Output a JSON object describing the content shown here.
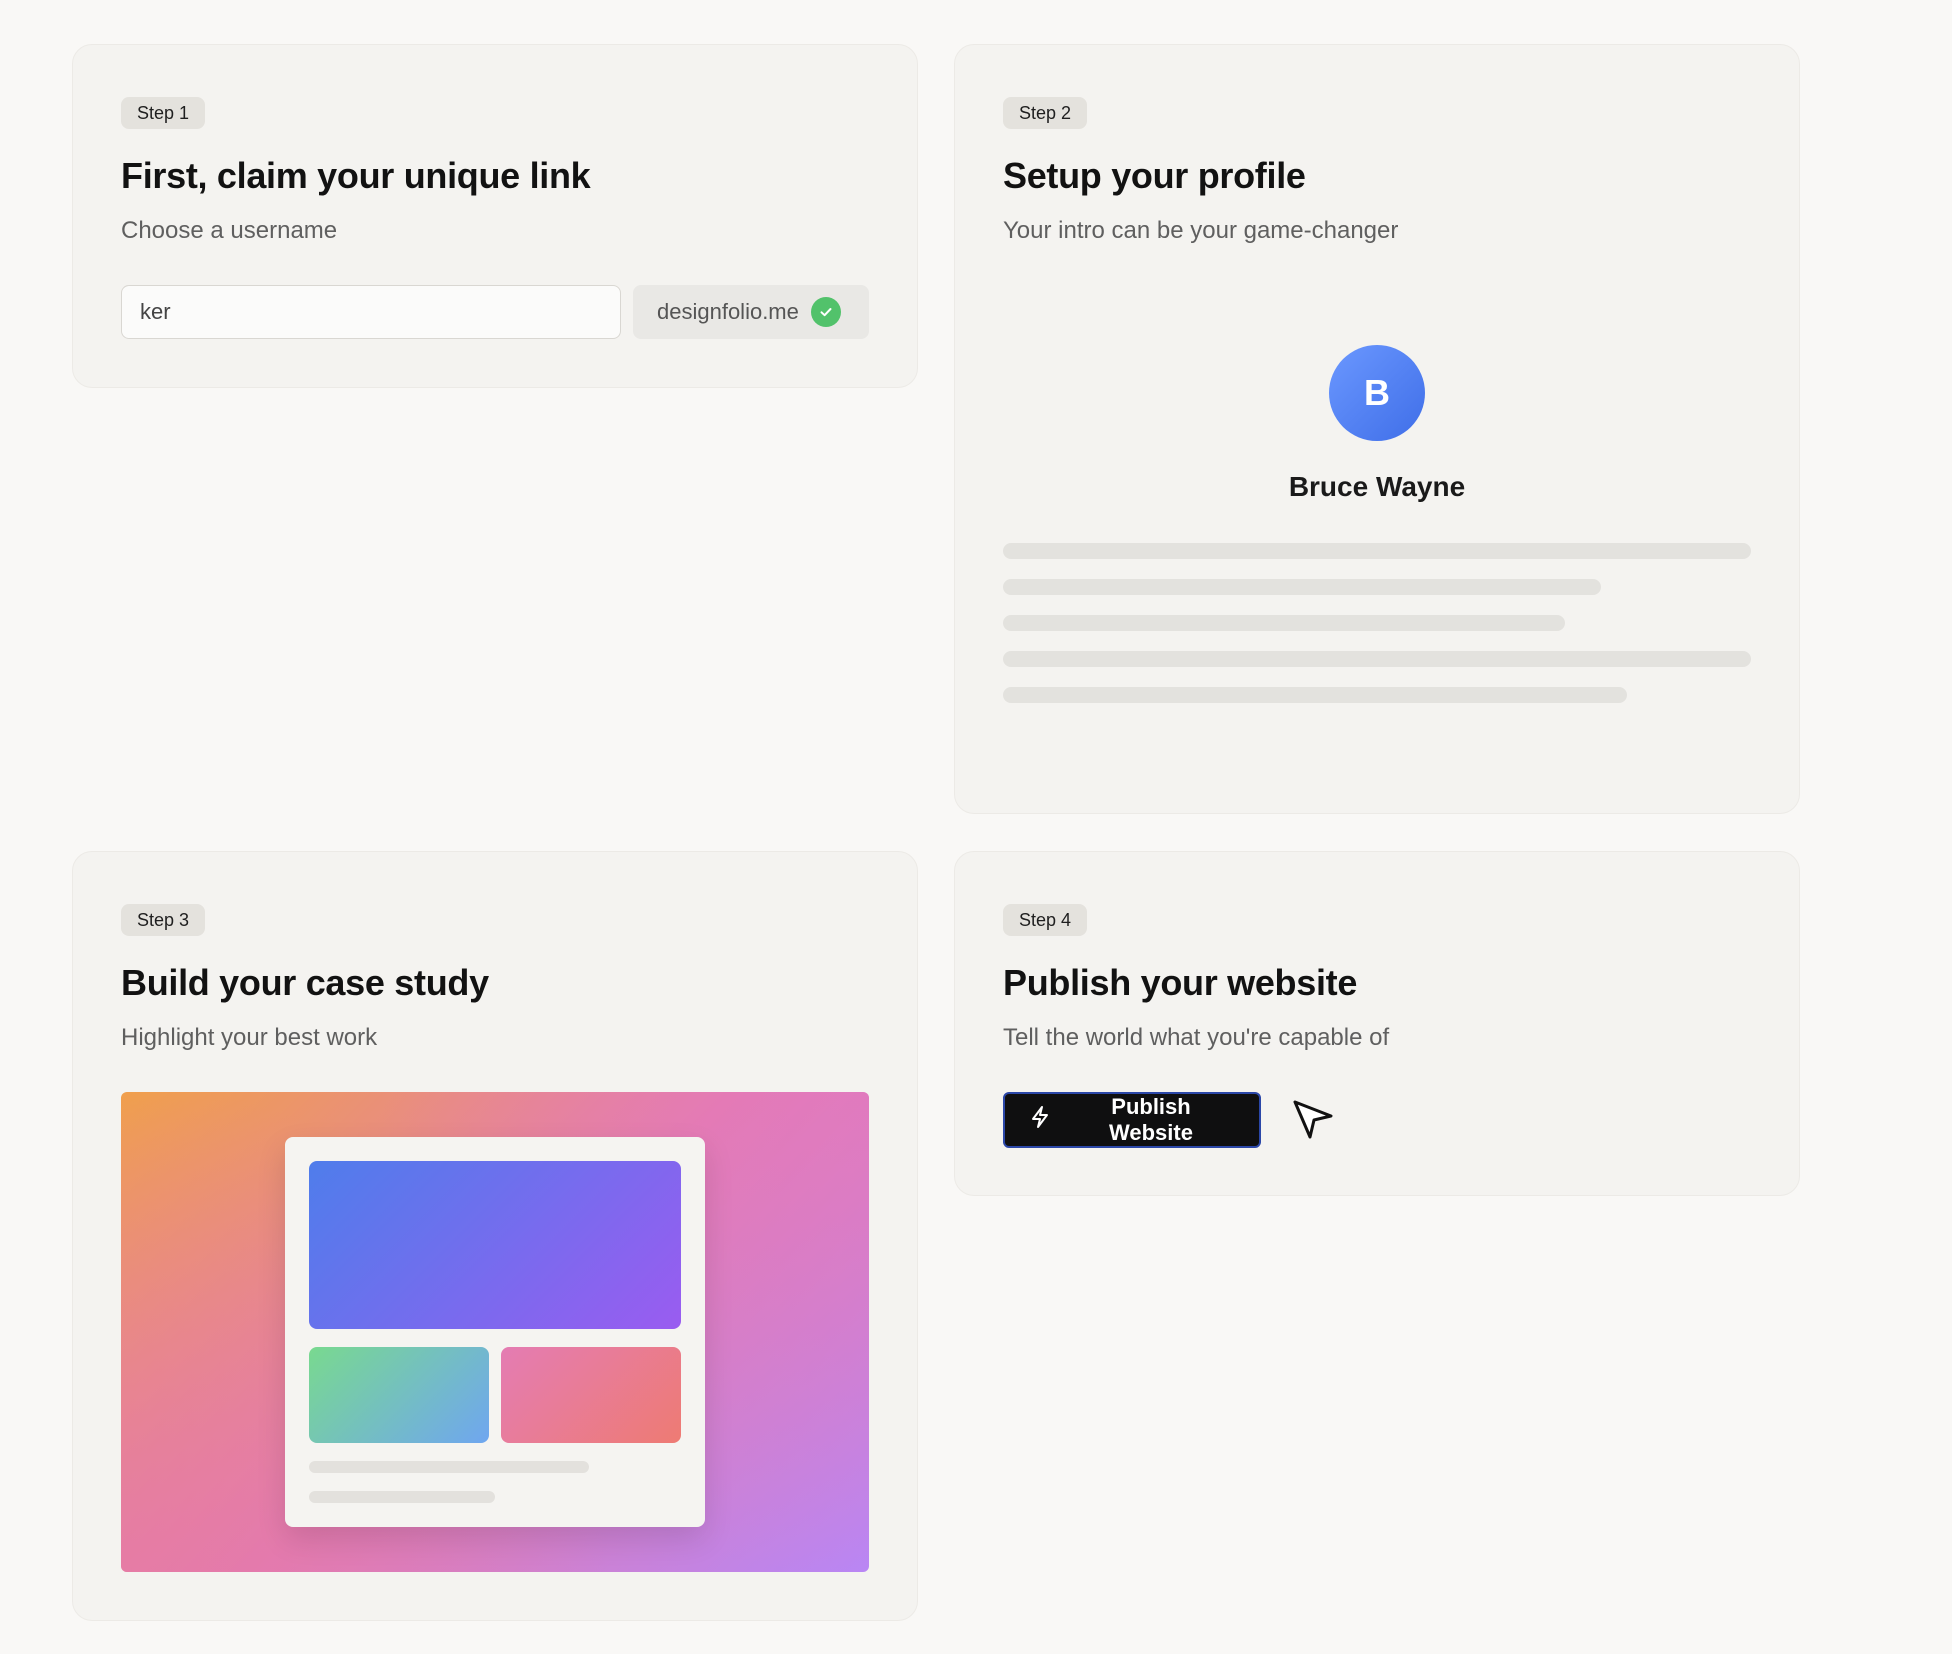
{
  "steps": [
    {
      "badge": "Step 1",
      "title": "First, claim your unique link",
      "subtitle": "Choose a username"
    },
    {
      "badge": "Step 2",
      "title": "Setup your profile",
      "subtitle": "Your intro can be your game-changer"
    },
    {
      "badge": "Step 3",
      "title": "Build your case study",
      "subtitle": "Highlight your best work"
    },
    {
      "badge": "Step 4",
      "title": "Publish your website",
      "subtitle": "Tell the world what you're capable of"
    }
  ],
  "claim": {
    "username_value": "ker",
    "domain": "designfolio.me",
    "available_icon": "check-circle-icon"
  },
  "profile": {
    "avatar_initial": "B",
    "name": "Bruce Wayne"
  },
  "publish": {
    "button_label": "Publish Website",
    "button_icon": "lightning-icon",
    "cursor_icon": "pointer-arrow-icon"
  },
  "colors": {
    "page_bg": "#f9f8f6",
    "card_bg": "#f4f3f0",
    "success": "#52c26b",
    "avatar": "#4f7ff0",
    "button_bg": "#0f0f10"
  }
}
